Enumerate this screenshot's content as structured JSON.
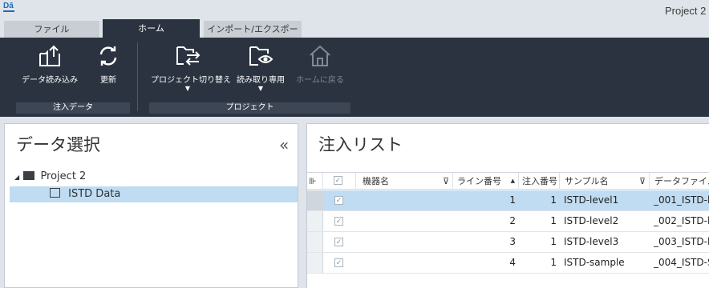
{
  "app": {
    "logo": "Dā",
    "title": "Project 2"
  },
  "tabs": [
    {
      "label": "ファイル"
    },
    {
      "label": "ホーム"
    },
    {
      "label": "インポート/エクスポート"
    }
  ],
  "ribbon": {
    "groups": [
      {
        "label": "注入データ",
        "buttons": [
          {
            "label": "データ読み込み",
            "icon": "import-icon"
          },
          {
            "label": "更新",
            "icon": "refresh-icon"
          }
        ]
      },
      {
        "label": "プロジェクト",
        "buttons": [
          {
            "label": "プロジェクト切り替え",
            "icon": "folder-switch-icon"
          },
          {
            "label": "読み取り専用",
            "icon": "folder-view-icon"
          },
          {
            "label": "ホームに戻る",
            "icon": "home-icon"
          }
        ]
      }
    ]
  },
  "left": {
    "title": "データ選択",
    "collapse": "«",
    "tree": [
      {
        "label": "Project 2",
        "expander": "◢"
      },
      {
        "label": "ISTD Data"
      }
    ]
  },
  "right": {
    "title": "注入リスト",
    "columns": [
      "機器名",
      "ライン番号",
      "注入番号",
      "サンプル名",
      "データファイル"
    ],
    "rows": [
      {
        "line": "1",
        "inj": "1",
        "sample": "ISTD-level1",
        "file": "_001_ISTD-l"
      },
      {
        "line": "2",
        "inj": "1",
        "sample": "ISTD-level2",
        "file": "_002_ISTD-l"
      },
      {
        "line": "3",
        "inj": "1",
        "sample": "ISTD-level3",
        "file": "_003_ISTD-l"
      },
      {
        "line": "4",
        "inj": "1",
        "sample": "ISTD-sample",
        "file": "_004_ISTD-S"
      }
    ],
    "check": "✓"
  },
  "colors": {
    "ribbon": "#2b3340",
    "selection": "#bfdcf2",
    "accent": "#1e6bb8"
  }
}
